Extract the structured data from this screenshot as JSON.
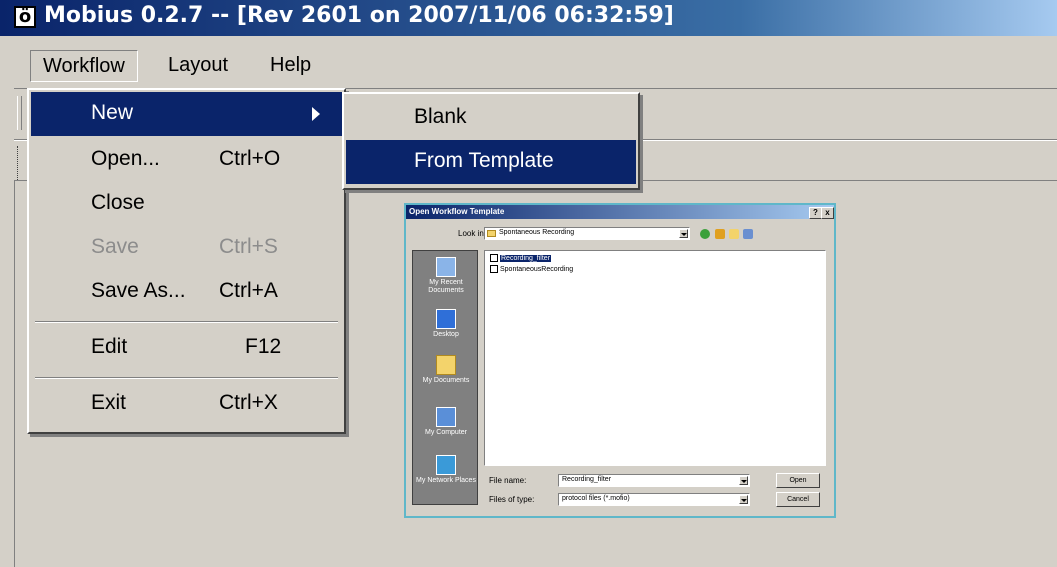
{
  "window": {
    "icon_glyph": "ö",
    "title": "Mobius 0.2.7 -- [Rev 2601 on 2007/11/06 06:32:59]"
  },
  "menubar": [
    "Workflow",
    "Layout",
    "Help"
  ],
  "dropdown": {
    "items": [
      {
        "label": "New",
        "shortcut": ""
      },
      {
        "label": "Open...",
        "shortcut": "Ctrl+O"
      },
      {
        "label": "Close",
        "shortcut": ""
      },
      {
        "label": "Save",
        "shortcut": "Ctrl+S"
      },
      {
        "label": "Save As...",
        "shortcut": "Ctrl+A"
      },
      {
        "label": "Edit",
        "shortcut": "F12"
      },
      {
        "label": "Exit",
        "shortcut": "Ctrl+X"
      }
    ]
  },
  "submenu": [
    "Blank",
    "From Template"
  ],
  "dialog": {
    "title": "Open Workflow Template",
    "help_btn": "?",
    "close_btn": "x",
    "look_in_label": "Look in:",
    "look_in_value": "Spontaneous Recording",
    "places": [
      "My Recent Documents",
      "Desktop",
      "My Documents",
      "My Computer",
      "My Network Places"
    ],
    "files": [
      "Recording_filter",
      "SpontaneousRecording"
    ],
    "file_name_label": "File name:",
    "file_name_value": "Recording_filter",
    "files_of_type_label": "Files of type:",
    "files_of_type_value": "protocol files (*.mofio)",
    "open_btn": "Open",
    "cancel_btn": "Cancel"
  },
  "colors": {
    "selection": "#0a246a",
    "face": "#d4d0c8",
    "disabled": "#8c8c8c"
  }
}
